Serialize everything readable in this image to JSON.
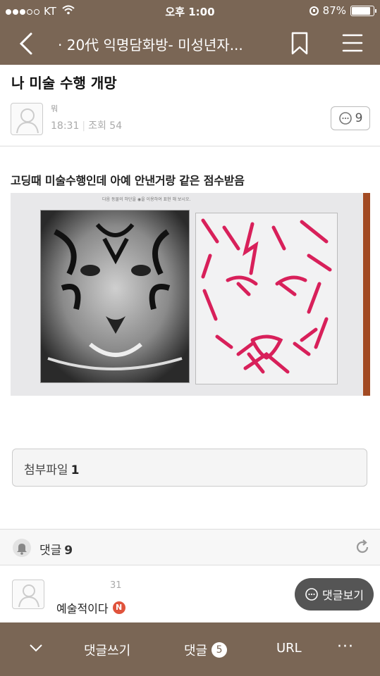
{
  "status_bar": {
    "carrier": "KT",
    "time": "오후 1:00",
    "battery": "87%",
    "battery_level": 0.87,
    "signal_bars": 3,
    "signal_total": 5
  },
  "nav": {
    "title": "· 20代 익명담화방- 미성년자...",
    "icons": [
      "back-icon",
      "bookmark-icon",
      "menu-icon"
    ]
  },
  "post": {
    "title": "나 미술 수행 개망",
    "author": "뭐",
    "time": "18:31",
    "views_label": "조회 54",
    "comment_count": "9",
    "body": "고딩때 미술수행인데 아예 안낸거랑 같은 점수받음",
    "worksheet_caption": "다음 동물의 하단을 ◉을 이용하여 표현 해 보시오."
  },
  "attachment": {
    "label": "첨부파일",
    "count": "1"
  },
  "comments": {
    "label": "댓글",
    "count": "9",
    "first": {
      "time": "31",
      "text": "예술적이다",
      "badge": "N"
    },
    "view_button": "댓글보기"
  },
  "bottom_bar": {
    "write": "댓글쓰기",
    "comments": "댓글",
    "comments_badge": "5",
    "url": "URL",
    "more": "···"
  },
  "colors": {
    "chrome": "#7a6655",
    "badge_red": "#e0533c",
    "view_button_bg": "#555555"
  }
}
